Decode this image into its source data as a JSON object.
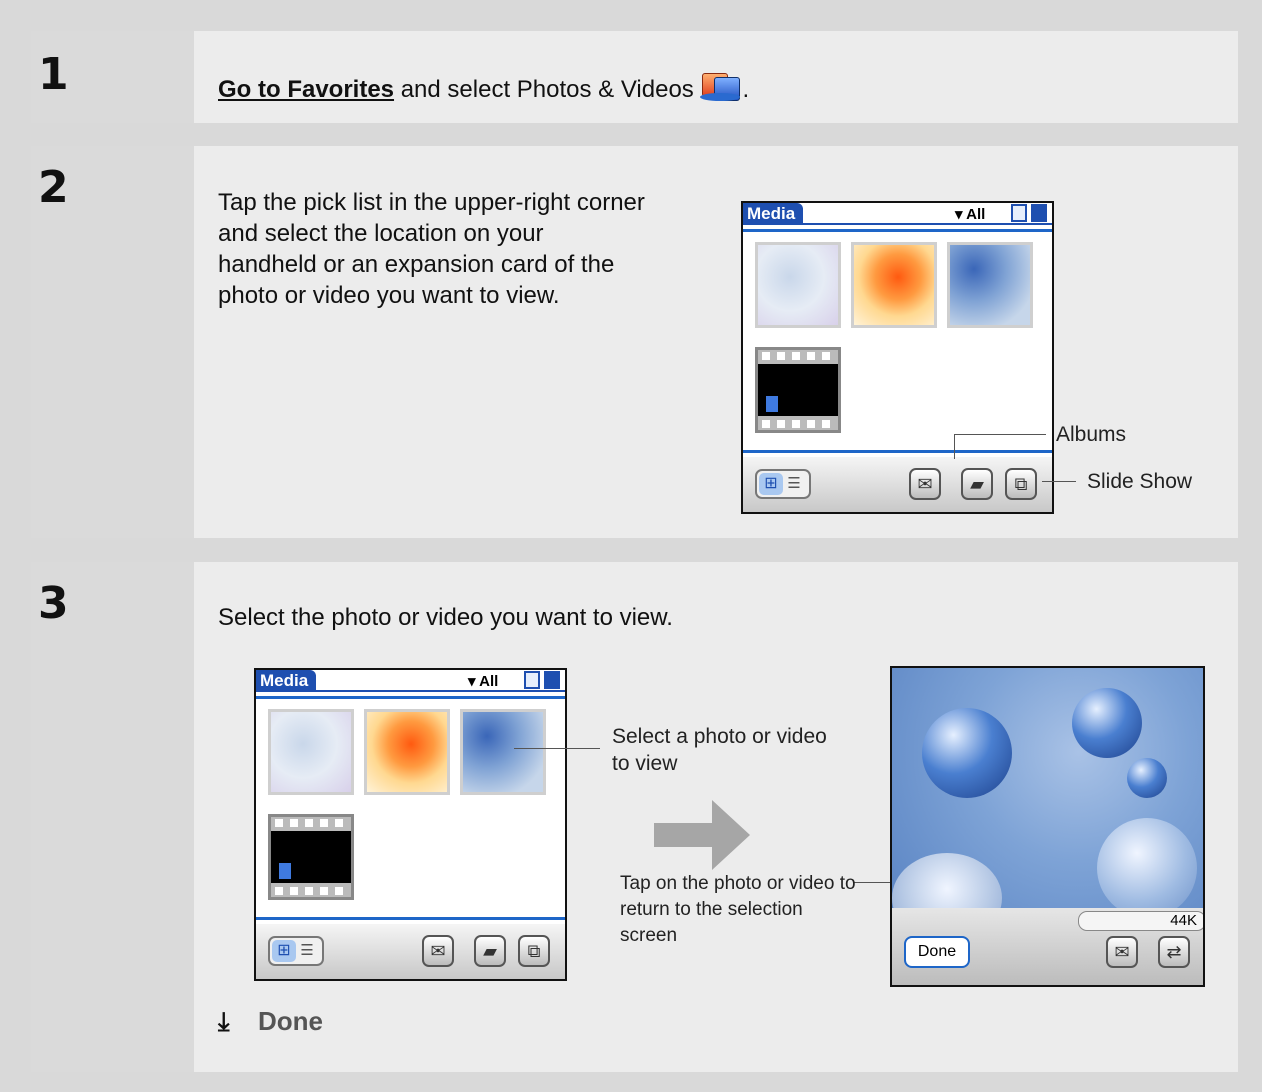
{
  "steps": [
    {
      "number": "1",
      "link": "Go to Favorites",
      "text": " and select Photos & Videos ",
      "icon": "photos-videos-icon"
    },
    {
      "number": "2",
      "text": "Tap the pick list in the upper-right corner and select the location on your handheld or an expansion card of the photo or video you want to view.",
      "callouts": {
        "albums": "Albums",
        "slideshow": "Slide Show"
      }
    },
    {
      "number": "3",
      "text": "Select the photo or video you want to view.",
      "callouts": {
        "select": "Select a photo or video to view",
        "tap": "Tap on the photo or video to return to the selection screen"
      },
      "done": "Done"
    }
  ],
  "palm": {
    "title": "Media",
    "picklist": "All"
  },
  "viewer": {
    "size": "44K",
    "done_button": "Done"
  }
}
